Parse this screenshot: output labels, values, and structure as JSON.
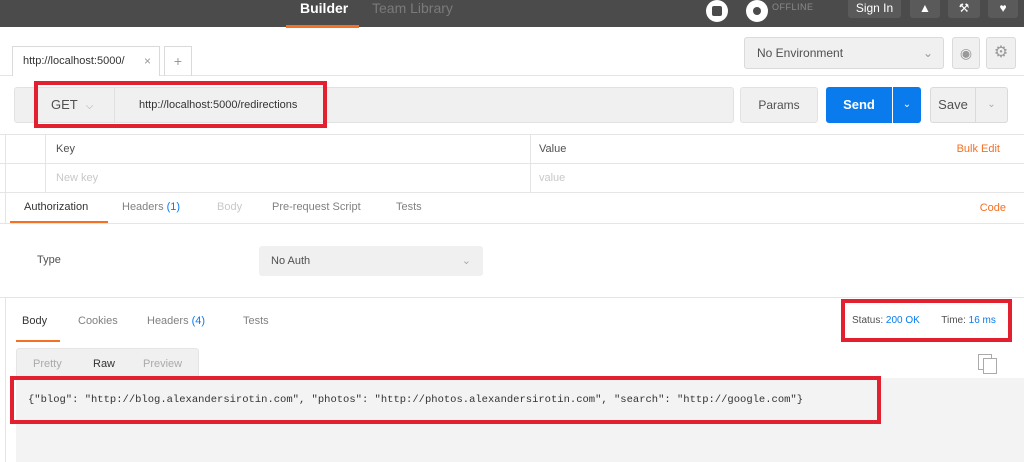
{
  "topbar": {
    "builder": "Builder",
    "team_library": "Team Library",
    "offline": "OFFLINE",
    "sign_in": "Sign In"
  },
  "tabs": {
    "request_tab": "http://localhost:5000/",
    "close": "×",
    "add": "+"
  },
  "environment": {
    "selected": "No Environment"
  },
  "request": {
    "method": "GET",
    "url": "http://localhost:5000/redirections",
    "params_label": "Params",
    "send_label": "Send",
    "save_label": "Save"
  },
  "params_table": {
    "key_header": "Key",
    "value_header": "Value",
    "bulk_edit": "Bulk Edit",
    "new_key_placeholder": "New key",
    "value_placeholder": "value"
  },
  "request_tabs": {
    "authorization": "Authorization",
    "headers": "Headers",
    "headers_count": "(1)",
    "body": "Body",
    "pre_request": "Pre-request Script",
    "tests": "Tests",
    "code": "Code"
  },
  "auth": {
    "type_label": "Type",
    "selected": "No Auth"
  },
  "response_tabs": {
    "body": "Body",
    "cookies": "Cookies",
    "headers": "Headers",
    "headers_count": "(4)",
    "tests": "Tests",
    "status_label": "Status:",
    "status_value": "200 OK",
    "time_label": "Time:",
    "time_value": "16 ms"
  },
  "view_tabs": {
    "pretty": "Pretty",
    "raw": "Raw",
    "preview": "Preview"
  },
  "response_body": "{\"blog\": \"http://blog.alexandersirotin.com\", \"photos\": \"http://photos.alexandersirotin.com\", \"search\": \"http://google.com\"}",
  "colors": {
    "accent": "#f47023",
    "send": "#097bed",
    "highlight": "#e3202f"
  }
}
